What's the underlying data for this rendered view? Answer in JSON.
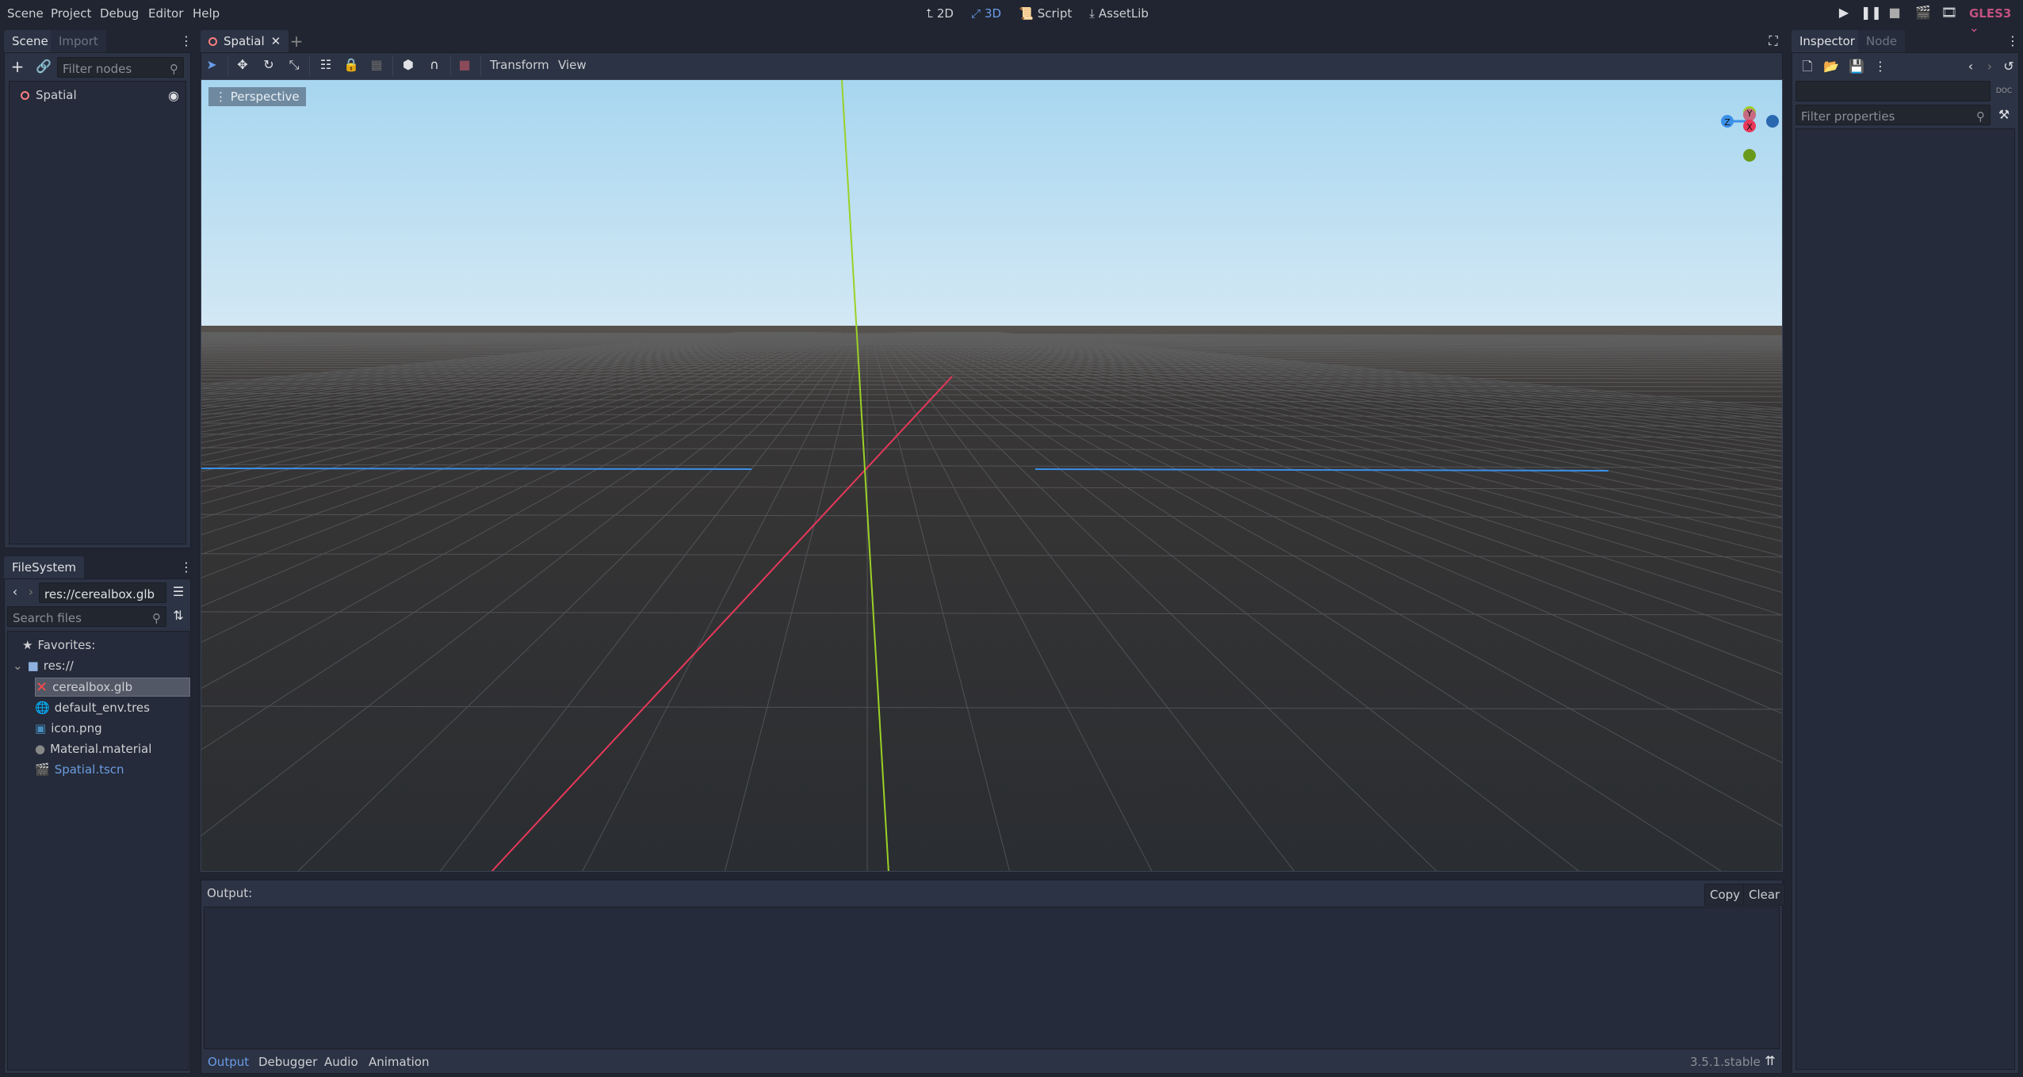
{
  "menubar": {
    "items": [
      "Scene",
      "Project",
      "Debug",
      "Editor",
      "Help"
    ]
  },
  "workspaces": [
    {
      "label": "2D",
      "icon": "2d-icon"
    },
    {
      "label": "3D",
      "icon": "3d-icon",
      "active": true
    },
    {
      "label": "Script",
      "icon": "script-icon"
    },
    {
      "label": "AssetLib",
      "icon": "download-icon"
    }
  ],
  "renderer": {
    "label": "GLES3",
    "color": "#c2517f"
  },
  "scene_dock": {
    "tabs": [
      "Scene",
      "Import"
    ],
    "filter_placeholder": "Filter nodes",
    "tree": [
      {
        "label": "Spatial",
        "icon": "spatial-node-icon",
        "visible": true
      }
    ]
  },
  "filesystem": {
    "tab": "FileSystem",
    "path": "res://cerealbox.glb",
    "search_placeholder": "Search files",
    "favorites_label": "Favorites:",
    "root": "res://",
    "files": [
      {
        "name": "cerealbox.glb",
        "icon": "error-x-icon",
        "selected": true
      },
      {
        "name": "default_env.tres",
        "icon": "globe-icon"
      },
      {
        "name": "icon.png",
        "icon": "image-icon"
      },
      {
        "name": "Material.material",
        "icon": "material-sphere-icon"
      },
      {
        "name": "Spatial.tscn",
        "icon": "scene-clapper-icon",
        "highlight": true
      }
    ]
  },
  "editor": {
    "scene_tab": "Spatial",
    "toolbar": {
      "transform": "Transform",
      "view": "View"
    },
    "viewport_label": "Perspective",
    "gizmo": {
      "y": "Y",
      "x": "X",
      "z": "Z"
    },
    "colors": {
      "x_axis": "#e8385a",
      "y_axis": "#9ad126",
      "z_axis": "#3a8fe8",
      "sky": "#a8d7f1"
    }
  },
  "output": {
    "label": "Output:",
    "copy": "Copy",
    "clear": "Clear",
    "tabs": [
      "Output",
      "Debugger",
      "Audio",
      "Animation"
    ],
    "version": "3.5.1.stable"
  },
  "inspector": {
    "tabs": [
      "Inspector",
      "Node"
    ],
    "filter_placeholder": "Filter properties"
  }
}
